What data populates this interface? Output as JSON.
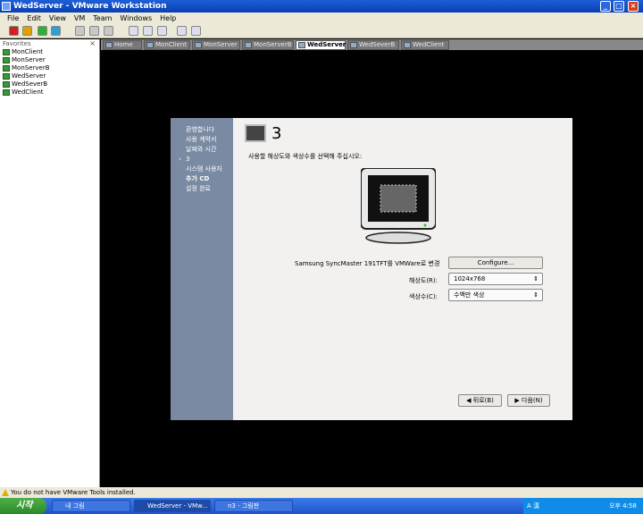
{
  "window": {
    "title": "WedServer - VMware Workstation",
    "min": "_",
    "max": "□",
    "close": "×"
  },
  "menu": [
    "File",
    "Edit",
    "View",
    "VM",
    "Team",
    "Windows",
    "Help"
  ],
  "sidebar": {
    "header": "Favorites",
    "close": "×",
    "items": [
      "MonClient",
      "MonServer",
      "MonServerB",
      "WedServer",
      "WedSeverB",
      "WedClient"
    ]
  },
  "tabs": [
    "Home",
    "MonClient",
    "MonServer",
    "MonServerB",
    "WedServer",
    "WedSeverB",
    "WedClient"
  ],
  "active_tab": "WedServer",
  "guest": {
    "steps": [
      "환영합니다",
      "사용 계약서",
      "날짜와 시간",
      "3",
      "시스템 사용자",
      "추가 CD",
      "설정 완료"
    ],
    "current_step_marker": "›",
    "heading": "3",
    "instruction": "사용할 해상도와 색상수를 선택해 주십시오:",
    "monitor_label": "Samsung SyncMaster 191TFT를 VMWare로 변경",
    "configure_button": "Configure...",
    "resolution_label": "해상도(R):",
    "resolution_value": "1024x768",
    "depth_label": "색상수(C):",
    "depth_value": "수백만 색상",
    "back_button": "뒤로(B)",
    "next_button": "다음(N)"
  },
  "status": {
    "text": "You do not have VMware Tools installed."
  },
  "taskbar": {
    "start": "시작",
    "tasks": [
      "내 그림",
      "WedServer - VMw...",
      "n3 - 그림판"
    ],
    "tray_text": "A 漢",
    "clock": "오후 4:58"
  },
  "colors": {
    "titlebar": "#0a3fb3",
    "guest_sidebar": "#7a8aa3",
    "guest_bg": "#f2f1ef",
    "vm_bg": "#000000"
  }
}
